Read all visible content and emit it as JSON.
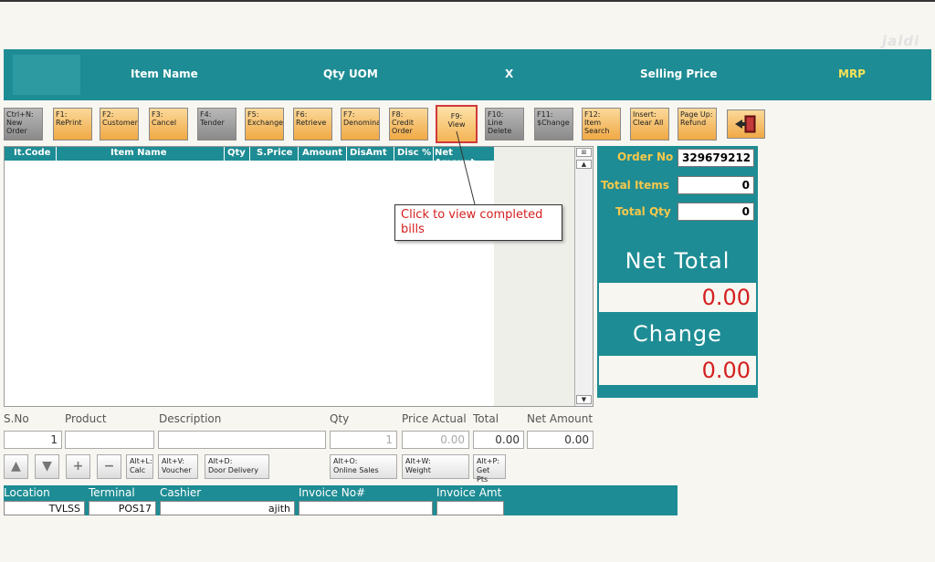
{
  "header": {
    "columns": [
      "Item Name",
      "Qty UOM",
      "X",
      "Selling Price",
      "MRP"
    ],
    "watermark": "jaldi"
  },
  "toolbar": {
    "keys": [
      {
        "label": "Ctrl+N:\nNew\nOrder",
        "style": "gray"
      },
      {
        "label": "F1:\nRePrint",
        "style": "orange"
      },
      {
        "label": "F2:\nCustomer",
        "style": "orange"
      },
      {
        "label": "F3:\nCancel",
        "style": "orange"
      },
      {
        "label": "F4:\nTender",
        "style": "gray"
      },
      {
        "label": "F5:\nExchange",
        "style": "orange"
      },
      {
        "label": "F6:\nRetrieve",
        "style": "orange"
      },
      {
        "label": "F7:\nDenomina",
        "style": "orange"
      },
      {
        "label": "F8:\nCredit\nOrder",
        "style": "orange"
      },
      {
        "label": "F9:\nView",
        "style": "highlight"
      },
      {
        "label": "F10:\nLine\nDelete",
        "style": "gray"
      },
      {
        "label": "F11:\n$Change",
        "style": "gray"
      },
      {
        "label": "F12:\nItem\nSearch",
        "style": "orange"
      },
      {
        "label": "Insert:\nClear All",
        "style": "orange"
      },
      {
        "label": "Page Up:\nRefund",
        "style": "orange"
      }
    ]
  },
  "grid": {
    "columns": [
      "It.Code",
      "Item Name",
      "Qty",
      "S.Price",
      "Amount",
      "DisAmt",
      "Disc %",
      "Net Amount"
    ]
  },
  "callout": {
    "text": "Click to view completed bills"
  },
  "summary": {
    "order_no_label": "Order No",
    "order_no": "329679212",
    "total_items_label": "Total Items",
    "total_items": "0",
    "total_qty_label": "Total Qty",
    "total_qty": "0",
    "net_total_label": "Net Total",
    "net_total": "0.00",
    "change_label": "Change",
    "change": "0.00"
  },
  "entry": {
    "sno_label": "S.No",
    "sno": "1",
    "product_label": "Product",
    "product": "",
    "description_label": "Description",
    "description": "",
    "qty_label": "Qty",
    "qty": "1",
    "price_actual_label": "Price Actual",
    "price_actual": "0.00",
    "total_label": "Total",
    "total": "0.00",
    "net_amount_label": "Net Amount",
    "net_amount": "0.00"
  },
  "actions": {
    "calc": "Alt+L:\nCalc",
    "voucher": "Alt+V:\nVoucher",
    "door_delivery": "Alt+D:\nDoor Delivery",
    "online_sales": "Alt+O:\nOnline Sales",
    "weight": "Alt+W:\nWeight",
    "get_pts": "Alt+P:\nGet Pts"
  },
  "status": {
    "location_label": "Location",
    "location": "TVLSS",
    "terminal_label": "Terminal",
    "terminal": "POS17",
    "cashier_label": "Cashier",
    "cashier": "ajith",
    "invoice_no_label": "Invoice No#",
    "invoice_no": "",
    "invoice_amt_label": "Invoice Amt",
    "invoice_amt": ""
  },
  "colors": {
    "teal": "#1e8c94",
    "orange": "#f0a945",
    "accent_red": "#d42020",
    "label_gold": "#f5c84b"
  }
}
